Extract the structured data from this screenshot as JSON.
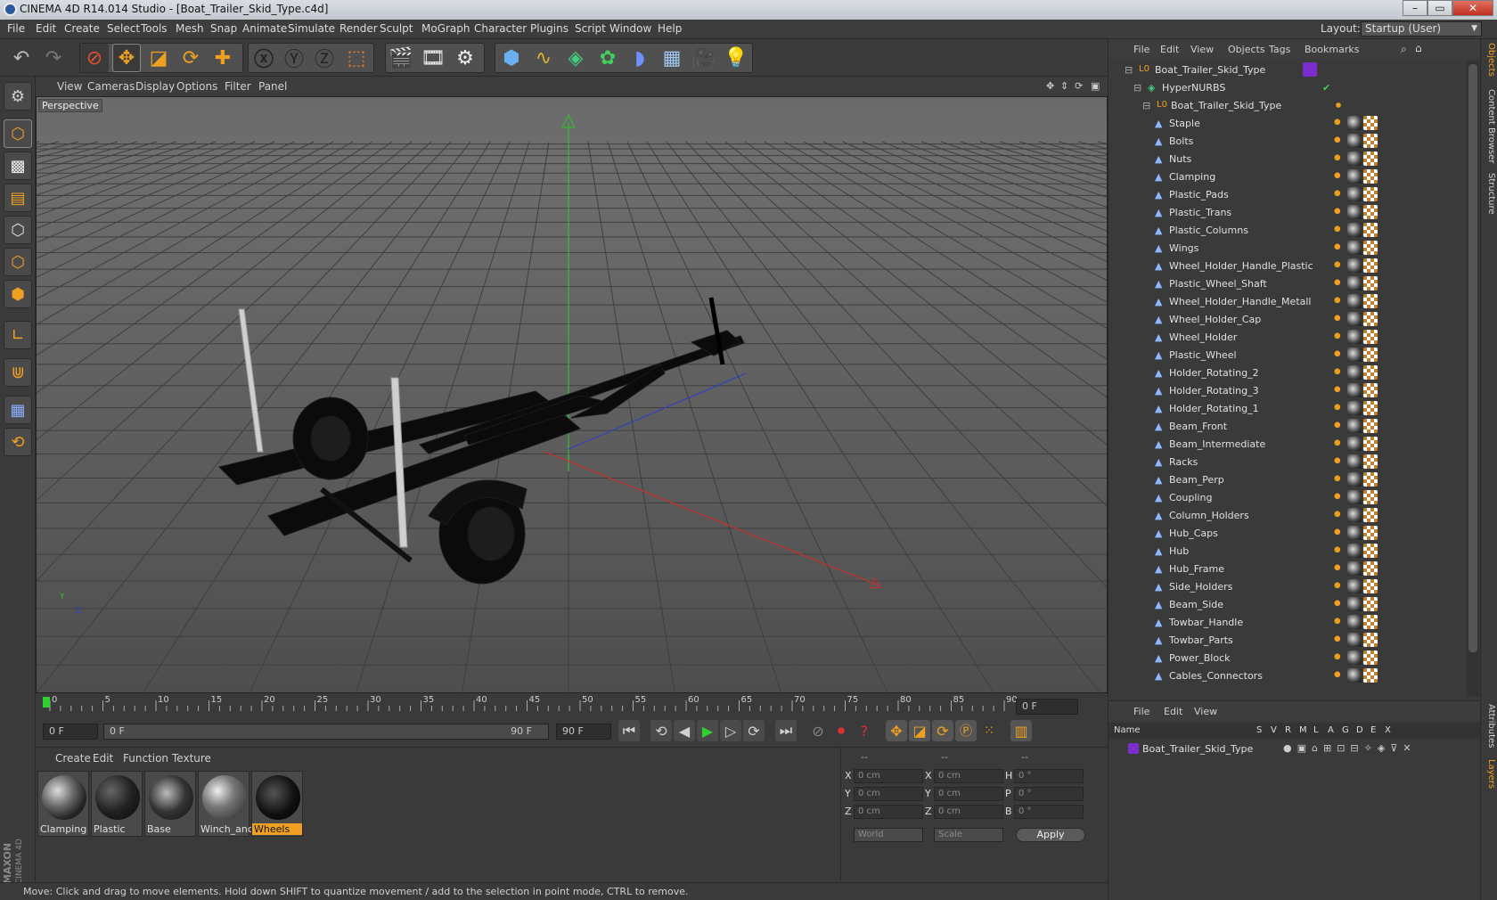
{
  "app": {
    "title": "CINEMA 4D R14.014 Studio - [Boat_Trailer_Skid_Type.c4d]",
    "layout_label": "Layout:",
    "layout_value": "Startup (User)"
  },
  "menu": [
    "File",
    "Edit",
    "Create",
    "Select",
    "Tools",
    "Mesh",
    "Snap",
    "Animate",
    "Simulate",
    "Render",
    "Sculpt",
    "MoGraph",
    "Character",
    "Plugins",
    "Script",
    "Window",
    "Help"
  ],
  "viewport": {
    "menu": [
      "View",
      "Cameras",
      "Display",
      "Options",
      "Filter",
      "Panel"
    ],
    "label": "Perspective",
    "axis_y": "Y",
    "axis_z": "Z"
  },
  "timeline": {
    "ticks": [
      "0",
      "5",
      "10",
      "15",
      "20",
      "25",
      "30",
      "35",
      "40",
      "45",
      "50",
      "55",
      "60",
      "65",
      "70",
      "75",
      "80",
      "85",
      "90"
    ],
    "current_frame": "0 F",
    "start_field": "0 F",
    "range_start": "0 F",
    "range_end": "90 F",
    "end_field": "90 F"
  },
  "materials": {
    "menu": [
      "Create",
      "Edit",
      "Function",
      "Texture"
    ],
    "items": [
      {
        "name": "Clamping",
        "selected": false
      },
      {
        "name": "Plastic",
        "selected": false
      },
      {
        "name": "Base",
        "selected": false
      },
      {
        "name": "Winch_anc",
        "selected": false
      },
      {
        "name": "Wheels",
        "selected": true
      }
    ]
  },
  "attributes": {
    "headers": [
      "--",
      "--",
      "--"
    ],
    "rows": [
      {
        "a": "X",
        "av": "0 cm",
        "b": "X",
        "bv": "0 cm",
        "c": "H",
        "cv": "0 °"
      },
      {
        "a": "Y",
        "av": "0 cm",
        "b": "Y",
        "bv": "0 cm",
        "c": "P",
        "cv": "0 °"
      },
      {
        "a": "Z",
        "av": "0 cm",
        "b": "Z",
        "bv": "0 cm",
        "c": "B",
        "cv": "0 °"
      }
    ],
    "coord_mode": "World",
    "scale_mode": "Scale",
    "apply": "Apply"
  },
  "objects": {
    "menu": [
      "File",
      "Edit",
      "View",
      "Objects",
      "Tags",
      "Bookmarks"
    ],
    "root": "Boat_Trailer_Skid_Type",
    "nurbs": "HyperNURBS",
    "group": "Boat_Trailer_Skid_Type",
    "items": [
      "Staple",
      "Bolts",
      "Nuts",
      "Clamping",
      "Plastic_Pads",
      "Plastic_Trans",
      "Plastic_Columns",
      "Wings",
      "Wheel_Holder_Handle_Plastic",
      "Plastic_Wheel_Shaft",
      "Wheel_Holder_Handle_Metall",
      "Wheel_Holder_Cap",
      "Wheel_Holder",
      "Plastic_Wheel",
      "Holder_Rotating_2",
      "Holder_Rotating_3",
      "Holder_Rotating_1",
      "Beam_Front",
      "Beam_Intermediate",
      "Racks",
      "Beam_Perp",
      "Coupling",
      "Column_Holders",
      "Hub_Caps",
      "Hub",
      "Hub_Frame",
      "Side_Holders",
      "Beam_Side",
      "Towbar_Handle",
      "Towbar_Parts",
      "Power_Block",
      "Cables_Connectors"
    ]
  },
  "layers": {
    "menu": [
      "File",
      "Edit",
      "View"
    ],
    "columns": [
      "Name",
      "S",
      "V",
      "R",
      "M",
      "L",
      "A",
      "G",
      "D",
      "E",
      "X"
    ],
    "row": "Boat_Trailer_Skid_Type"
  },
  "right_tabs": [
    "Objects",
    "Content Browser",
    "Structure",
    "Attributes",
    "Layers"
  ],
  "status": "Move: Click and drag to move elements. Hold down SHIFT to quantize movement / add to the selection in point mode, CTRL to remove.",
  "brand": [
    "MAXON",
    "CINEMA 4D"
  ],
  "colors": {
    "accent_orange": "#f0a020",
    "layer_purple": "#7a2ccc",
    "axis_x": "#d03030",
    "axis_y": "#30c030",
    "axis_z": "#3040d0"
  }
}
